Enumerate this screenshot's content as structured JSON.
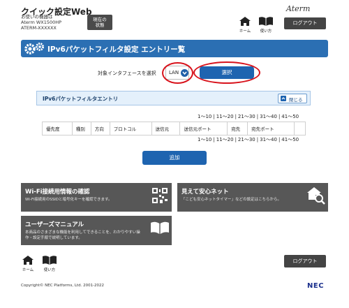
{
  "header": {
    "app_title": "クイック設定Web",
    "device_lines": [
      "お使いの機器は",
      "Aterm WX1500HP",
      "ATERM-XXXXXX"
    ],
    "status_button": [
      "現在の",
      "状態"
    ],
    "brand": "Aterm",
    "nav": {
      "home_label": "ホーム",
      "manual_label": "使い方"
    },
    "logout_label": "ログアウト"
  },
  "page": {
    "title": "IPv6パケットフィルタ設定 エントリー覧"
  },
  "interface": {
    "label": "対象インタフェースを選択",
    "selected": "LAN",
    "select_button": "選択"
  },
  "entry_panel": {
    "title": "IPv6パケットフィルタエントリ",
    "close_label": "閉じる"
  },
  "pager": [
    "1～10",
    "11～20",
    "21～30",
    "31～40",
    "41～50"
  ],
  "pager_separator": "|",
  "table": {
    "headers": [
      "優先度",
      "種別",
      "方向",
      "プロトコル",
      "送信元",
      "送信元ポート",
      "宛先",
      "宛先ポート",
      ""
    ]
  },
  "add_button": "追加",
  "tiles": {
    "wifi": {
      "title": "Wi-Fi接続用情報の確認",
      "desc": "Wi-Fi接続用のSSIDと暗号化キーを確認できます。"
    },
    "safe": {
      "title": "見えて安心ネット",
      "desc": "「こども安心ネットタイマー」などの設定はこちらから。"
    },
    "manual": {
      "title": "ユーザーズマニュアル",
      "desc": [
        "本商品のさまざまな機能を利用してできることを、わかりやすい操",
        "作・設定手順で説明しています。"
      ]
    }
  },
  "footer": {
    "home_label": "ホーム",
    "manual_label": "使い方",
    "logout_label": "ログアウト",
    "copyright": "Copyright© NEC Platforms, Ltd. 2001-2022",
    "maker": "NEC"
  },
  "colors": {
    "accent": "#1e64b0",
    "highlight_ring": "#d8121b",
    "tile_bg": "#575757"
  }
}
